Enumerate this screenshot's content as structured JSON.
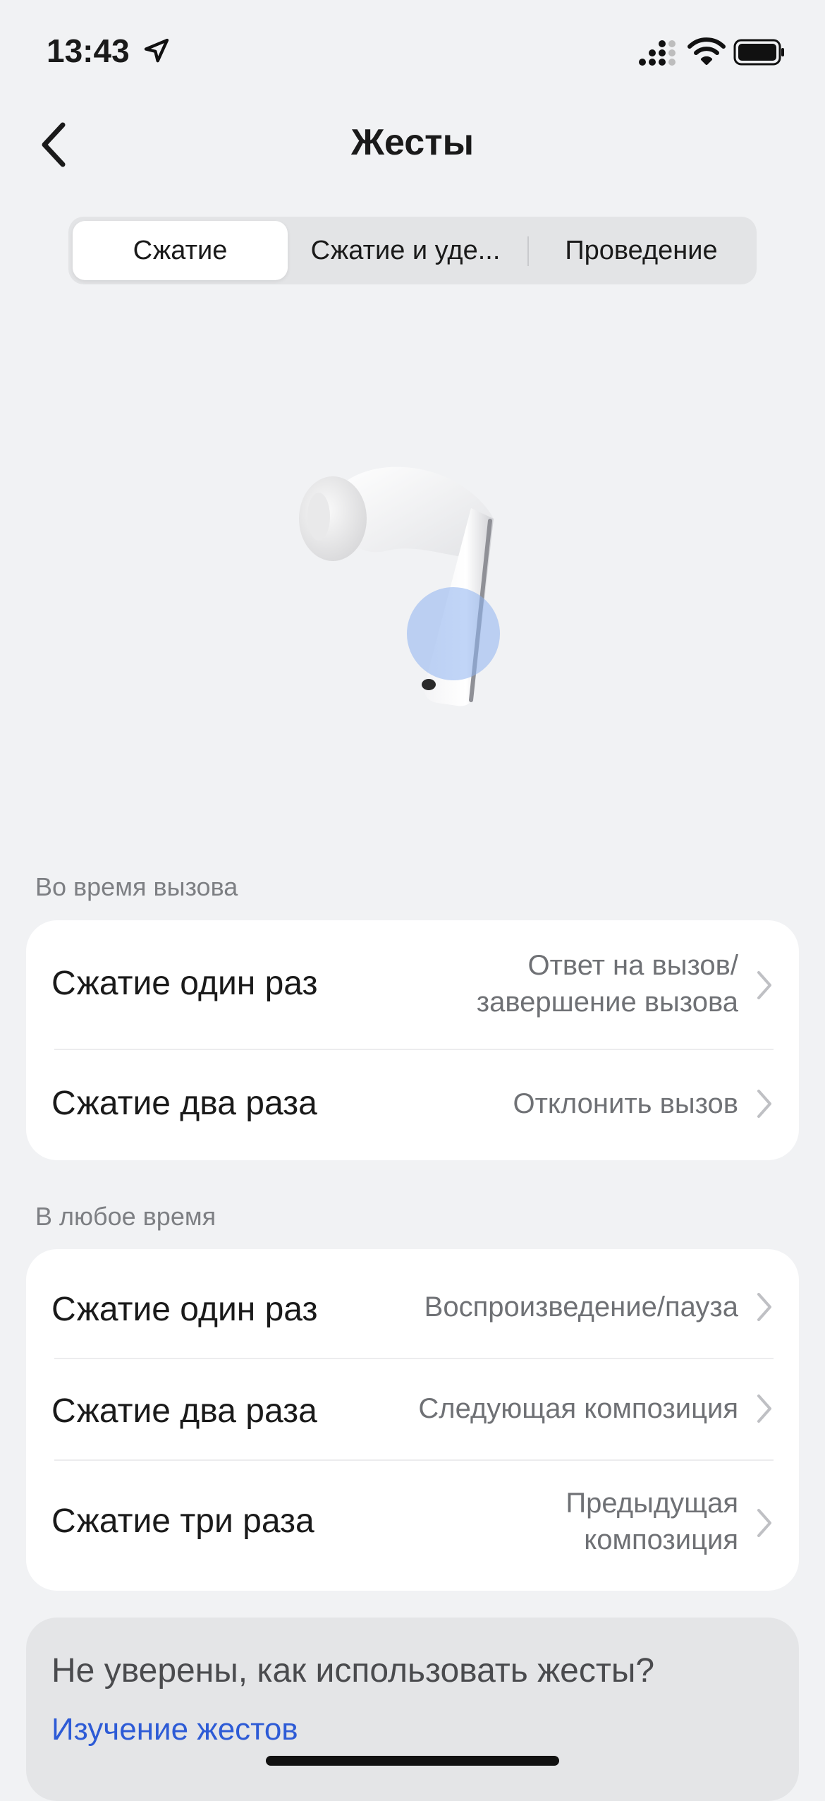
{
  "status_bar": {
    "time": "13:43",
    "icons": [
      "location-arrow-icon",
      "cellular-signal-icon",
      "wifi-icon",
      "battery-icon"
    ]
  },
  "nav": {
    "title": "Жесты",
    "back_icon": "chevron-left-icon"
  },
  "segments": [
    {
      "label": "Сжатие",
      "selected": true
    },
    {
      "label": "Сжатие и уде...",
      "selected": false
    },
    {
      "label": "Проведение",
      "selected": false
    }
  ],
  "illustration": {
    "name": "earbud-image",
    "highlight_color": "#8eb2f0"
  },
  "during_call": {
    "header": "Во время вызова",
    "rows": [
      {
        "label": "Сжатие один раз",
        "value_line1": "Ответ на вызов/",
        "value_line2": "завершение вызова"
      },
      {
        "label": "Сжатие два раза",
        "value_line1": "Отклонить вызов"
      }
    ]
  },
  "any_time": {
    "header": "В любое время",
    "rows": [
      {
        "label": "Сжатие один раз",
        "value_line1": "Воспроизведение/пауза"
      },
      {
        "label": "Сжатие два раза",
        "value_line1": "Следующая композиция"
      },
      {
        "label": "Сжатие три раза",
        "value_line1": "Предыдущая",
        "value_line2": "композиция"
      }
    ]
  },
  "learn": {
    "question": "Не уверены, как использовать жесты?",
    "link": "Изучение жестов"
  },
  "colors": {
    "background": "#f1f2f4",
    "card": "#ffffff",
    "link": "#2d5bd6",
    "secondary_text": "#6f7175"
  }
}
